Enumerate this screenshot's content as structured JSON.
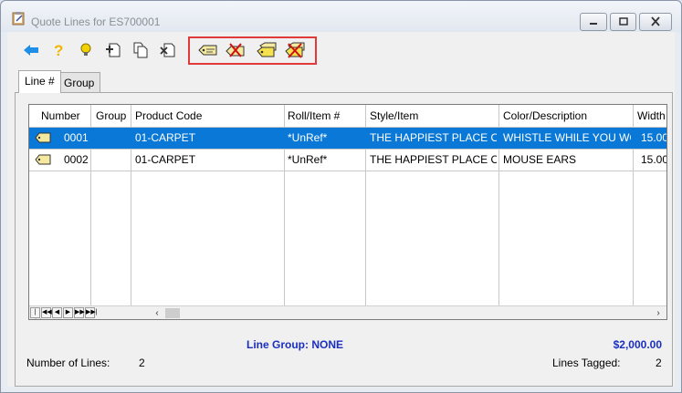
{
  "window": {
    "title": "Quote Lines for ES700001"
  },
  "tabs": [
    {
      "label": "Line #",
      "active": true
    },
    {
      "label": "Group",
      "active": false
    }
  ],
  "grid": {
    "columns": [
      "Number",
      "Group",
      "Product Code",
      "Roll/Item #",
      "Style/Item",
      "Color/Description",
      "Width"
    ],
    "rows": [
      {
        "number": "0001",
        "group": "",
        "product_code": "01-CARPET",
        "roll_item": "*UnRef*",
        "style_item": "THE HAPPIEST PLACE ON",
        "color_description": "WHISTLE WHILE YOU WOR",
        "width": "15.00",
        "selected": true
      },
      {
        "number": "0002",
        "group": "",
        "product_code": "01-CARPET",
        "roll_item": "*UnRef*",
        "style_item": "THE HAPPIEST PLACE ON",
        "color_description": "MOUSE EARS",
        "width": "15.00",
        "selected": false
      }
    ],
    "nav_buttons": [
      "|◀◀",
      "◀◀",
      "◀",
      "▶",
      "▶▶",
      "▶▶|"
    ]
  },
  "summary": {
    "line_group": "Line Group: NONE",
    "total": "$2,000.00",
    "number_of_lines_label": "Number of Lines:",
    "number_of_lines_value": "2",
    "lines_tagged_label": "Lines Tagged:",
    "lines_tagged_value": "2"
  },
  "colors": {
    "selection": "#0a78d7",
    "accent_text": "#1a2fc0",
    "highlight_box": "#e03a3a"
  },
  "icons": {
    "toolbar": [
      "back-arrow-icon",
      "help-icon",
      "hint-bulb-icon",
      "add-document-icon",
      "copy-document-icon",
      "delete-document-icon",
      "tag-icon",
      "untag-icon",
      "tag-all-icon",
      "untag-all-icon"
    ]
  }
}
